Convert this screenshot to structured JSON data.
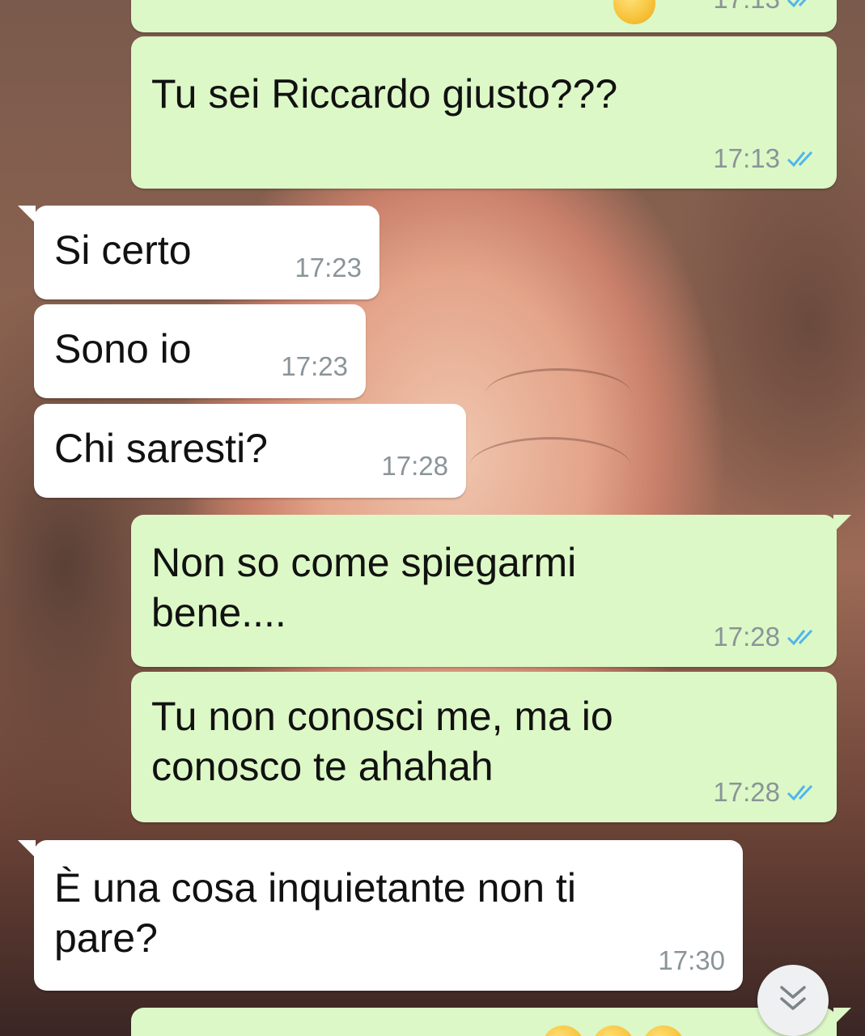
{
  "messages": [
    {
      "id": "m0",
      "direction": "out",
      "text": "",
      "time": "17:13",
      "status": "read"
    },
    {
      "id": "m1",
      "direction": "out",
      "text": "Tu sei Riccardo giusto???",
      "time": "17:13",
      "status": "read"
    },
    {
      "id": "m2",
      "direction": "in",
      "text": "Si certo",
      "time": "17:23"
    },
    {
      "id": "m3",
      "direction": "in",
      "text": "Sono io",
      "time": "17:23"
    },
    {
      "id": "m4",
      "direction": "in",
      "text": "Chi saresti?",
      "time": "17:28"
    },
    {
      "id": "m5",
      "direction": "out",
      "text": "Non so come spiegarmi\nbene....",
      "time": "17:28",
      "status": "read"
    },
    {
      "id": "m6",
      "direction": "out",
      "text": "Tu non conosci me, ma io\nconosco te ahahah",
      "time": "17:28",
      "status": "read"
    },
    {
      "id": "m7",
      "direction": "in",
      "text": "È una cosa inquietante non ti\npare?",
      "time": "17:30"
    }
  ],
  "icons": {
    "read_receipt": "double-check-icon",
    "scroll_down": "chevron-double-down-icon",
    "emoji": "grinning-face-emoji-icon"
  },
  "colors": {
    "outgoing_bubble": "#dcf8c6",
    "incoming_bubble": "#ffffff",
    "read_tick": "#4fb6ec",
    "timestamp": "#8a9499"
  }
}
